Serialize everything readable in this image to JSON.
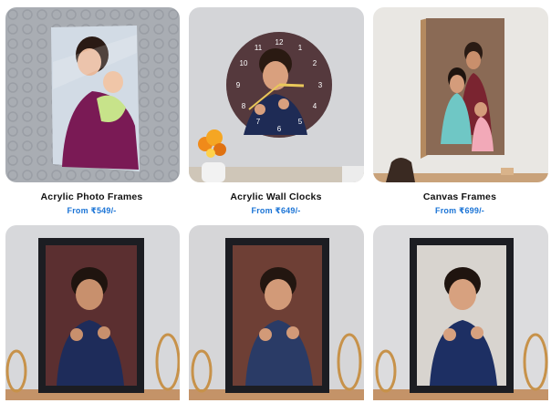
{
  "products": [
    {
      "title": "Acrylic Photo Frames",
      "price": "From ₹549/-"
    },
    {
      "title": "Acrylic Wall Clocks",
      "price": "From ₹649/-"
    },
    {
      "title": "Canvas Frames",
      "price": "From ₹699/-"
    },
    {
      "title": "",
      "price": ""
    },
    {
      "title": "",
      "price": ""
    },
    {
      "title": "",
      "price": ""
    }
  ],
  "clock": {
    "numbers": [
      "12",
      "1",
      "2",
      "3",
      "4",
      "5",
      "6",
      "7",
      "8",
      "9",
      "10",
      "11"
    ]
  },
  "colors": {
    "price": "#1b74d6",
    "title": "#111111",
    "card_bg": "#dcdcdc"
  }
}
